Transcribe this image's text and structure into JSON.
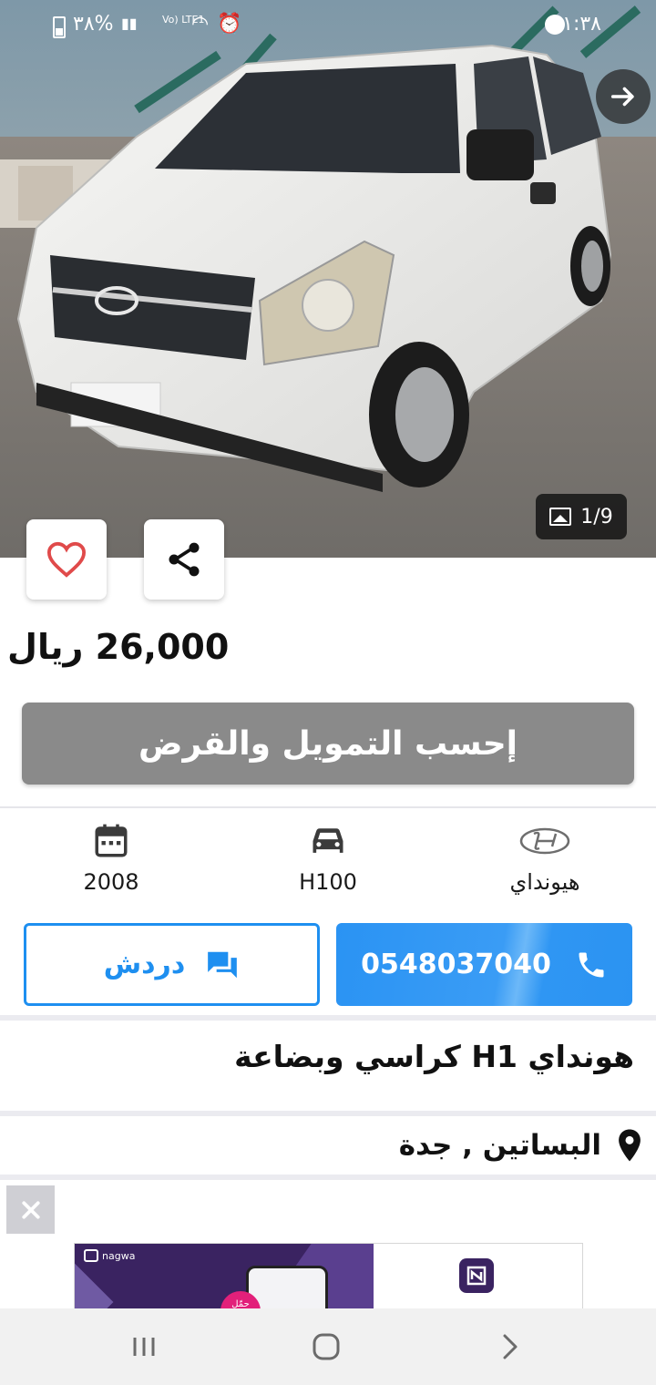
{
  "status_bar": {
    "time": "١:٣٨",
    "battery_percent": "٣٨%",
    "network_label": "Vo) LTE1"
  },
  "gallery": {
    "counter": "1/9"
  },
  "listing": {
    "price": "26,000 ريال",
    "finance_button_label": "إحسب التمويل والقرض",
    "specs": {
      "year": "2008",
      "model": "H100",
      "brand": "هيونداي"
    },
    "phone": "0548037040",
    "chat_label": "دردش",
    "title": "هونداي H1 كراسي وبضاعة",
    "location": "البساتين , جدة"
  },
  "ad": {
    "brand_name": "nagwa",
    "cta": "حمّل"
  },
  "colors": {
    "accent_blue": "#1e8ff0",
    "finance_gray": "#8a8a8a",
    "favorite_red": "#e04a4a",
    "ad_purple": "#3a2361"
  },
  "icons": {
    "favorite": "heart-outline",
    "share": "share-nodes",
    "next": "arrow-right",
    "gallery": "image",
    "year": "calendar",
    "model": "car",
    "brand": "hyundai-logo",
    "chat": "chat-bubbles",
    "call": "phone",
    "location": "map-pin",
    "close_ad": "x",
    "nav_recents": "three-bars",
    "nav_home": "rounded-square",
    "nav_back": "chevron"
  }
}
